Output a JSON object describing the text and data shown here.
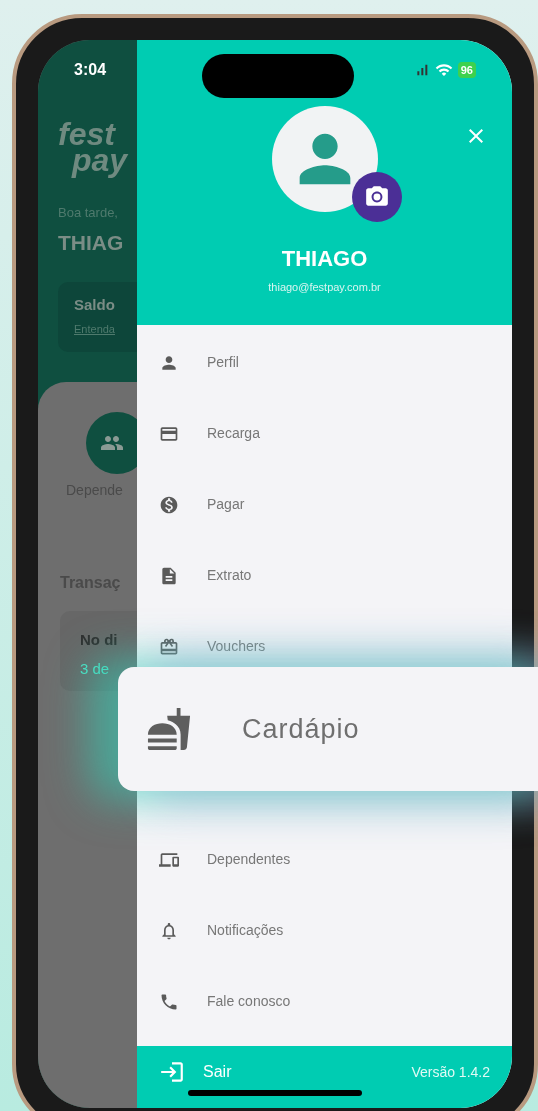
{
  "status_bar": {
    "time": "3:04",
    "battery": "96"
  },
  "background": {
    "logo_lines": [
      "fest",
      "pay"
    ],
    "greeting": "Boa tarde,",
    "name": "THIAG",
    "balance_title": "Saldo",
    "balance_link": "Entenda",
    "shortcut_label": "Depende",
    "section_title": "Transaç",
    "card_title": "No di",
    "card_subtitle": "3 de"
  },
  "drawer": {
    "name": "THIAGO",
    "email": "thiago@festpay.com.br",
    "menu": [
      {
        "label": "Perfil"
      },
      {
        "label": "Recarga"
      },
      {
        "label": "Pagar"
      },
      {
        "label": "Extrato"
      },
      {
        "label": "Vouchers"
      },
      {
        "label": "Dependentes"
      },
      {
        "label": "Notificações"
      },
      {
        "label": "Fale conosco"
      }
    ],
    "footer": {
      "logout": "Sair",
      "version": "Versão 1.4.2"
    }
  },
  "highlight": {
    "label": "Cardápio"
  }
}
